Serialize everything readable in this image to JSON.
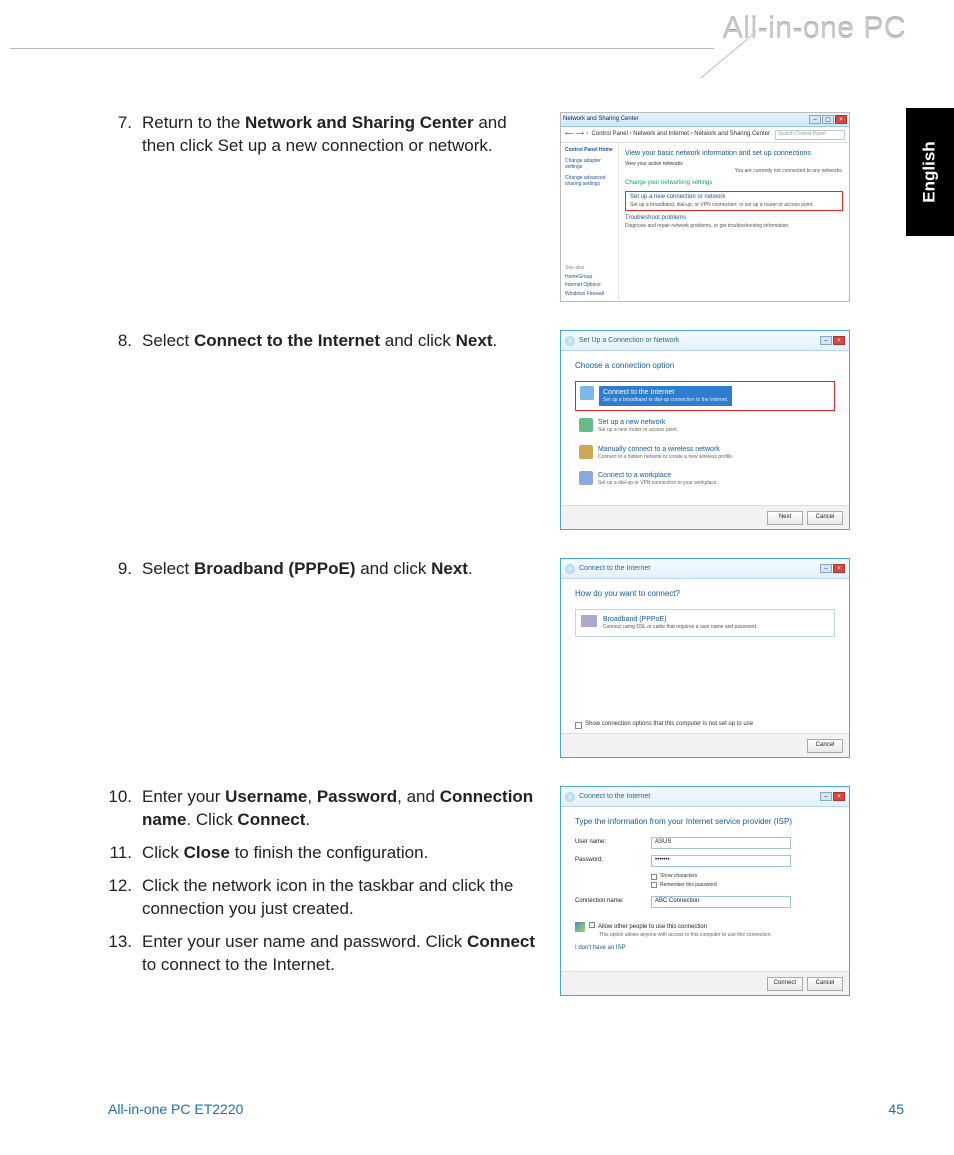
{
  "brand": "All-in-one PC",
  "lang_tab": "English",
  "steps": [
    {
      "num": "7.",
      "pre": "Return to the ",
      "b1": "Network and Sharing Center",
      "mid": " and then click Set up a new connection or network."
    },
    {
      "num": "8.",
      "pre": "Select ",
      "b1": "Connect to the Internet",
      "mid": " and click ",
      "b2": "Next",
      "post": "."
    },
    {
      "num": "9.",
      "pre": "Select ",
      "b1": "Broadband (PPPoE)",
      "mid": " and click ",
      "b2": "Next",
      "post": "."
    },
    {
      "num": "10.",
      "pre": "Enter your ",
      "b1": "Username",
      "mid1": ", ",
      "b2": "Password",
      "mid2": ", and ",
      "b3": "Connection name",
      "mid3": ". Click ",
      "b4": "Connect",
      "post": "."
    },
    {
      "num": "11.",
      "pre": "Click ",
      "b1": "Close",
      "mid": " to finish the configuration."
    },
    {
      "num": "12.",
      "plain": "Click the network icon in the taskbar and click the connection you just created."
    },
    {
      "num": "13.",
      "pre": "Enter your user name and password. Click ",
      "b1": "Connect",
      "mid": " to connect to the Internet."
    }
  ],
  "sc1": {
    "title": "Network and Sharing Center",
    "crumb": "Control Panel  ›  Network and Internet  ›  Network and Sharing Center",
    "search_ph": "Search Control Panel",
    "side_home": "Control Panel Home",
    "side1": "Change adapter settings",
    "side2": "Change advanced sharing settings",
    "heading": "View your basic network information and set up connections",
    "viewnet": "View your active networks",
    "notconn": "You are currently not connected to any networks.",
    "changeset": "Change your networking settings",
    "set_title": "Set up a new connection or network",
    "set_sub": "Set up a broadband, dial-up, or VPN connection; or set up a router or access point.",
    "troub_title": "Troubleshoot problems",
    "troub_sub": "Diagnose and repair network problems, or get troubleshooting information.",
    "seealso": "See also",
    "f1": "HomeGroup",
    "f2": "Internet Options",
    "f3": "Windows Firewall"
  },
  "sc2": {
    "title": "Set Up a Connection or Network",
    "q": "Choose a connection option",
    "o1m": "Connect to the Internet",
    "o1s": "Set up a broadband or dial-up connection to the Internet.",
    "o2m": "Set up a new network",
    "o2s": "Set up a new router or access point.",
    "o3m": "Manually connect to a wireless network",
    "o3s": "Connect to a hidden network or create a new wireless profile.",
    "o4m": "Connect to a workplace",
    "o4s": "Set up a dial-up or VPN connection to your workplace.",
    "next": "Next",
    "cancel": "Cancel"
  },
  "sc3": {
    "title": "Connect to the Internet",
    "q": "How do you want to connect?",
    "bbm": "Broadband (PPPoE)",
    "bbs": "Connect using DSL or cable that requires a user name and password.",
    "chk": "Show connection options that this computer is not set up to use",
    "cancel": "Cancel"
  },
  "sc4": {
    "title": "Connect to the Internet",
    "q": "Type the information from your Internet service provider (ISP)",
    "lab_user": "User name:",
    "val_user": "ASUS",
    "lab_pass": "Password:",
    "val_pass": "•••••••",
    "show": "Show characters",
    "rem": "Remember this password",
    "lab_conn": "Connection name:",
    "val_conn": "ABC Connection",
    "allow": "Allow other people to use this connection",
    "allow_sub": "This option allows anyone with access to this computer to use this connection.",
    "noisp": "I don't have an ISP",
    "connect": "Connect",
    "cancel": "Cancel"
  },
  "footer_model": "All-in-one PC ET2220",
  "footer_page": "45"
}
